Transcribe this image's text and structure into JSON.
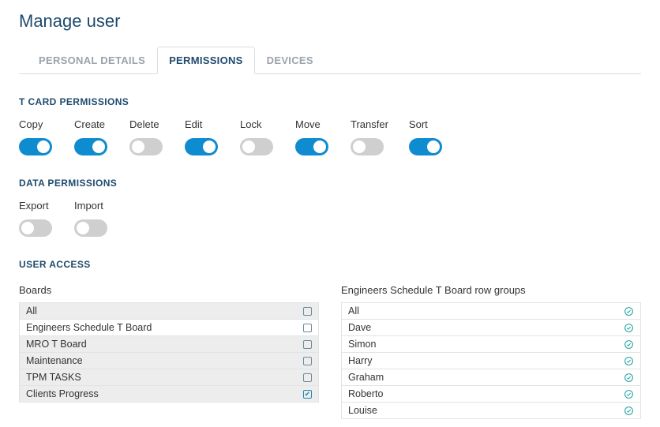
{
  "pageTitle": "Manage user",
  "tabs": [
    {
      "label": "PERSONAL DETAILS",
      "active": false
    },
    {
      "label": "PERMISSIONS",
      "active": true
    },
    {
      "label": "DEVICES",
      "active": false
    }
  ],
  "sections": {
    "tcard": {
      "title": "T CARD PERMISSIONS",
      "toggles": [
        {
          "label": "Copy",
          "on": true
        },
        {
          "label": "Create",
          "on": true
        },
        {
          "label": "Delete",
          "on": false
        },
        {
          "label": "Edit",
          "on": true
        },
        {
          "label": "Lock",
          "on": false
        },
        {
          "label": "Move",
          "on": true
        },
        {
          "label": "Transfer",
          "on": false
        },
        {
          "label": "Sort",
          "on": true
        }
      ]
    },
    "data": {
      "title": "DATA PERMISSIONS",
      "toggles": [
        {
          "label": "Export",
          "on": false
        },
        {
          "label": "Import",
          "on": false
        }
      ]
    },
    "access": {
      "title": "USER ACCESS",
      "boards": {
        "title": "Boards",
        "items": [
          {
            "label": "All",
            "checked": false,
            "selected": false
          },
          {
            "label": "Engineers Schedule T Board",
            "checked": false,
            "selected": true
          },
          {
            "label": "MRO T Board",
            "checked": false,
            "selected": false
          },
          {
            "label": "Maintenance",
            "checked": false,
            "selected": false
          },
          {
            "label": "TPM TASKS",
            "checked": false,
            "selected": false
          },
          {
            "label": "Clients Progress",
            "checked": true,
            "selected": false
          }
        ]
      },
      "rowGroups": {
        "title": "Engineers Schedule T Board row groups",
        "items": [
          {
            "label": "All",
            "checked": true
          },
          {
            "label": "Dave",
            "checked": true
          },
          {
            "label": "Simon",
            "checked": true
          },
          {
            "label": "Harry",
            "checked": true
          },
          {
            "label": "Graham",
            "checked": true
          },
          {
            "label": "Roberto",
            "checked": true
          },
          {
            "label": "Louise",
            "checked": true
          }
        ]
      }
    }
  }
}
